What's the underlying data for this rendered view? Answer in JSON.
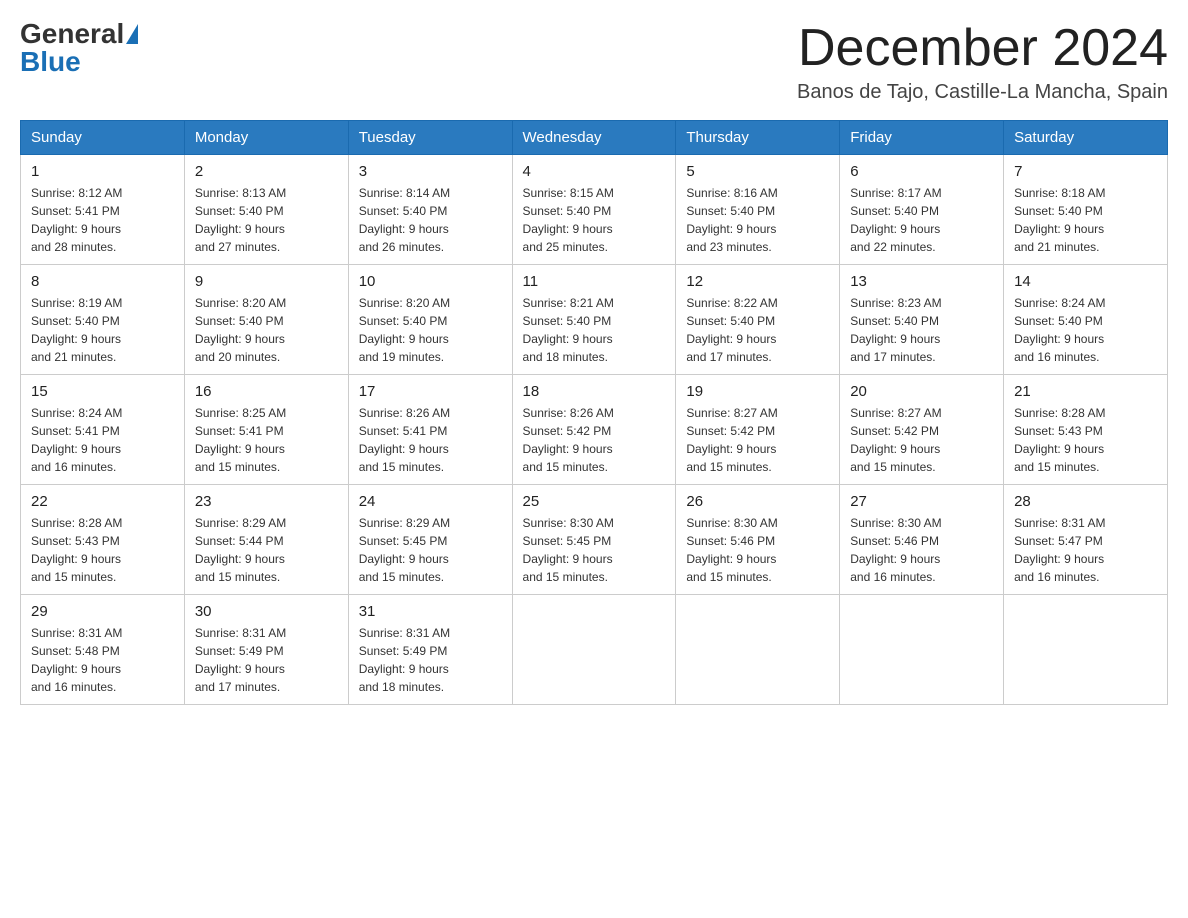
{
  "header": {
    "logo_general": "General",
    "logo_blue": "Blue",
    "month_title": "December 2024",
    "location": "Banos de Tajo, Castille-La Mancha, Spain"
  },
  "weekdays": [
    "Sunday",
    "Monday",
    "Tuesday",
    "Wednesday",
    "Thursday",
    "Friday",
    "Saturday"
  ],
  "weeks": [
    [
      {
        "day": "1",
        "sunrise": "8:12 AM",
        "sunset": "5:41 PM",
        "daylight": "9 hours and 28 minutes."
      },
      {
        "day": "2",
        "sunrise": "8:13 AM",
        "sunset": "5:40 PM",
        "daylight": "9 hours and 27 minutes."
      },
      {
        "day": "3",
        "sunrise": "8:14 AM",
        "sunset": "5:40 PM",
        "daylight": "9 hours and 26 minutes."
      },
      {
        "day": "4",
        "sunrise": "8:15 AM",
        "sunset": "5:40 PM",
        "daylight": "9 hours and 25 minutes."
      },
      {
        "day": "5",
        "sunrise": "8:16 AM",
        "sunset": "5:40 PM",
        "daylight": "9 hours and 23 minutes."
      },
      {
        "day": "6",
        "sunrise": "8:17 AM",
        "sunset": "5:40 PM",
        "daylight": "9 hours and 22 minutes."
      },
      {
        "day": "7",
        "sunrise": "8:18 AM",
        "sunset": "5:40 PM",
        "daylight": "9 hours and 21 minutes."
      }
    ],
    [
      {
        "day": "8",
        "sunrise": "8:19 AM",
        "sunset": "5:40 PM",
        "daylight": "9 hours and 21 minutes."
      },
      {
        "day": "9",
        "sunrise": "8:20 AM",
        "sunset": "5:40 PM",
        "daylight": "9 hours and 20 minutes."
      },
      {
        "day": "10",
        "sunrise": "8:20 AM",
        "sunset": "5:40 PM",
        "daylight": "9 hours and 19 minutes."
      },
      {
        "day": "11",
        "sunrise": "8:21 AM",
        "sunset": "5:40 PM",
        "daylight": "9 hours and 18 minutes."
      },
      {
        "day": "12",
        "sunrise": "8:22 AM",
        "sunset": "5:40 PM",
        "daylight": "9 hours and 17 minutes."
      },
      {
        "day": "13",
        "sunrise": "8:23 AM",
        "sunset": "5:40 PM",
        "daylight": "9 hours and 17 minutes."
      },
      {
        "day": "14",
        "sunrise": "8:24 AM",
        "sunset": "5:40 PM",
        "daylight": "9 hours and 16 minutes."
      }
    ],
    [
      {
        "day": "15",
        "sunrise": "8:24 AM",
        "sunset": "5:41 PM",
        "daylight": "9 hours and 16 minutes."
      },
      {
        "day": "16",
        "sunrise": "8:25 AM",
        "sunset": "5:41 PM",
        "daylight": "9 hours and 15 minutes."
      },
      {
        "day": "17",
        "sunrise": "8:26 AM",
        "sunset": "5:41 PM",
        "daylight": "9 hours and 15 minutes."
      },
      {
        "day": "18",
        "sunrise": "8:26 AM",
        "sunset": "5:42 PM",
        "daylight": "9 hours and 15 minutes."
      },
      {
        "day": "19",
        "sunrise": "8:27 AM",
        "sunset": "5:42 PM",
        "daylight": "9 hours and 15 minutes."
      },
      {
        "day": "20",
        "sunrise": "8:27 AM",
        "sunset": "5:42 PM",
        "daylight": "9 hours and 15 minutes."
      },
      {
        "day": "21",
        "sunrise": "8:28 AM",
        "sunset": "5:43 PM",
        "daylight": "9 hours and 15 minutes."
      }
    ],
    [
      {
        "day": "22",
        "sunrise": "8:28 AM",
        "sunset": "5:43 PM",
        "daylight": "9 hours and 15 minutes."
      },
      {
        "day": "23",
        "sunrise": "8:29 AM",
        "sunset": "5:44 PM",
        "daylight": "9 hours and 15 minutes."
      },
      {
        "day": "24",
        "sunrise": "8:29 AM",
        "sunset": "5:45 PM",
        "daylight": "9 hours and 15 minutes."
      },
      {
        "day": "25",
        "sunrise": "8:30 AM",
        "sunset": "5:45 PM",
        "daylight": "9 hours and 15 minutes."
      },
      {
        "day": "26",
        "sunrise": "8:30 AM",
        "sunset": "5:46 PM",
        "daylight": "9 hours and 15 minutes."
      },
      {
        "day": "27",
        "sunrise": "8:30 AM",
        "sunset": "5:46 PM",
        "daylight": "9 hours and 16 minutes."
      },
      {
        "day": "28",
        "sunrise": "8:31 AM",
        "sunset": "5:47 PM",
        "daylight": "9 hours and 16 minutes."
      }
    ],
    [
      {
        "day": "29",
        "sunrise": "8:31 AM",
        "sunset": "5:48 PM",
        "daylight": "9 hours and 16 minutes."
      },
      {
        "day": "30",
        "sunrise": "8:31 AM",
        "sunset": "5:49 PM",
        "daylight": "9 hours and 17 minutes."
      },
      {
        "day": "31",
        "sunrise": "8:31 AM",
        "sunset": "5:49 PM",
        "daylight": "9 hours and 18 minutes."
      },
      null,
      null,
      null,
      null
    ]
  ]
}
